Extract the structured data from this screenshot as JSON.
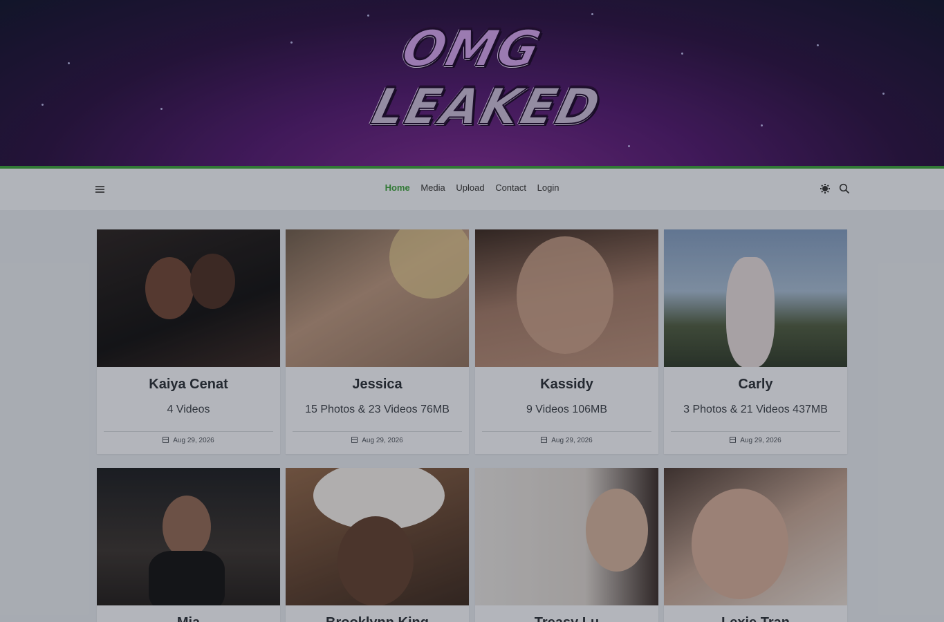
{
  "site": {
    "logo_top": "OMG",
    "logo_bottom": "LEAKED"
  },
  "nav": {
    "links": [
      {
        "label": "Home",
        "active": true
      },
      {
        "label": "Media",
        "active": false
      },
      {
        "label": "Upload",
        "active": false
      },
      {
        "label": "Contact",
        "active": false
      },
      {
        "label": "Login",
        "active": false
      }
    ]
  },
  "icons": {
    "menu": "menu-icon",
    "theme": "gear-icon",
    "search": "search-icon"
  },
  "colors": {
    "accent": "#3b9a3b"
  },
  "cards": [
    {
      "title": "Kaiya Cenat",
      "meta": "4 Videos",
      "date": "Aug 29, 2026"
    },
    {
      "title": "Jessica",
      "meta": "15 Photos & 23 Videos 76MB",
      "date": "Aug 29, 2026"
    },
    {
      "title": "Kassidy",
      "meta": "9 Videos 106MB",
      "date": "Aug 29, 2026"
    },
    {
      "title": "Carly",
      "meta": "3 Photos & 21 Videos 437MB",
      "date": "Aug 29, 2026"
    },
    {
      "title": "Mia",
      "meta": "",
      "date": ""
    },
    {
      "title": "Brooklynn King",
      "meta": "",
      "date": ""
    },
    {
      "title": "Treasy Lu",
      "meta": "",
      "date": ""
    },
    {
      "title": "Lexie Tran",
      "meta": "",
      "date": ""
    }
  ]
}
